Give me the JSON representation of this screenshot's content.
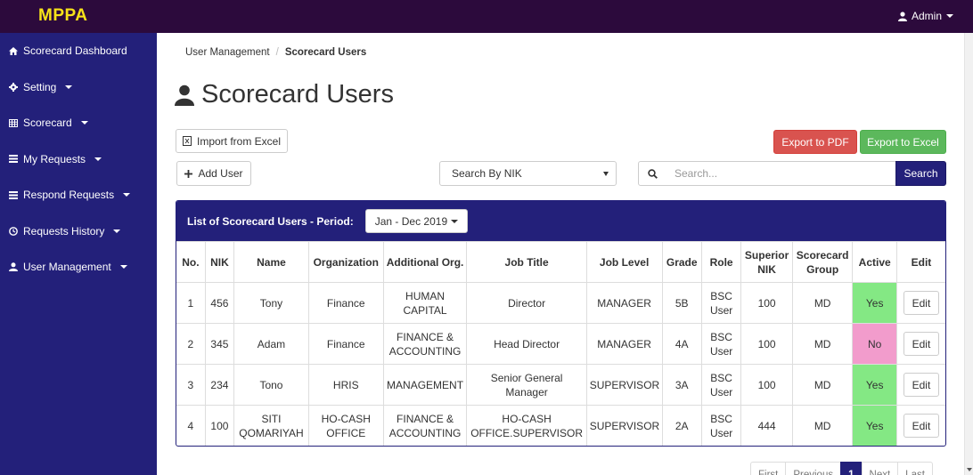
{
  "navbar": {
    "brand": "MPPA",
    "user_label": "Admin",
    "user_icon": "user-icon"
  },
  "sidebar": {
    "items": [
      {
        "label": "Scorecard Dashboard",
        "icon": "home-icon"
      },
      {
        "label": "Setting",
        "icon": "gear-icon"
      },
      {
        "label": "Scorecard",
        "icon": "table-icon"
      },
      {
        "label": "My Requests",
        "icon": "list-icon"
      },
      {
        "label": "Respond Requests",
        "icon": "list-icon"
      },
      {
        "label": "Requests History",
        "icon": "clock-icon"
      },
      {
        "label": "User Management",
        "icon": "user-icon"
      }
    ]
  },
  "breadcrumb": {
    "parent": "User Management",
    "separator": "/",
    "current": "Scorecard Users"
  },
  "page": {
    "title": "Scorecard Users"
  },
  "toolbar": {
    "import_label": "Import from Excel",
    "export_pdf_label": "Export to PDF",
    "export_excel_label": "Export to Excel",
    "add_user_label": "Add User",
    "search_by_value": "Search By NIK",
    "search_placeholder": "Search...",
    "search_button_label": "Search"
  },
  "panel": {
    "title": "List of Scorecard Users - Period:",
    "period_value": "Jan - Dec 2019"
  },
  "table": {
    "headers": {
      "no": "No.",
      "nik": "NIK",
      "name": "Name",
      "org": "Organization",
      "add_org": "Additional Org.",
      "job_title": "Job Title",
      "job_level": "Job Level",
      "grade": "Grade",
      "role": "Role",
      "superior": "Superior NIK",
      "group": "Scorecard Group",
      "active": "Active",
      "edit": "Edit"
    },
    "rows": [
      {
        "no": "1",
        "nik": "456",
        "name": "Tony",
        "org": "Finance",
        "add_org": "HUMAN CAPITAL",
        "job_title": "Director",
        "job_level": "MANAGER",
        "grade": "5B",
        "role": "BSC User",
        "superior": "100",
        "group": "MD",
        "active": "Yes",
        "edit": "Edit"
      },
      {
        "no": "2",
        "nik": "345",
        "name": "Adam",
        "org": "Finance",
        "add_org": "FINANCE & ACCOUNTING",
        "job_title": "Head Director",
        "job_level": "MANAGER",
        "grade": "4A",
        "role": "BSC User",
        "superior": "100",
        "group": "MD",
        "active": "No",
        "edit": "Edit"
      },
      {
        "no": "3",
        "nik": "234",
        "name": "Tono",
        "org": "HRIS",
        "add_org": "MANAGEMENT",
        "job_title": "Senior General Manager",
        "job_level": "SUPERVISOR",
        "grade": "3A",
        "role": "BSC User",
        "superior": "100",
        "group": "MD",
        "active": "Yes",
        "edit": "Edit"
      },
      {
        "no": "4",
        "nik": "100",
        "name": "SITI QOMARIYAH",
        "org": "HO-CASH OFFICE",
        "add_org": "FINANCE & ACCOUNTING",
        "job_title": "HO-CASH OFFICE.SUPERVISOR",
        "job_level": "SUPERVISOR",
        "grade": "2A",
        "role": "BSC User",
        "superior": "444",
        "group": "MD",
        "active": "Yes",
        "edit": "Edit"
      }
    ]
  },
  "pagination": {
    "first": "First",
    "previous": "Previous",
    "current": "1",
    "next": "Next",
    "last": "Last"
  },
  "colors": {
    "navbar_bg": "#2c0a3c",
    "sidebar_bg": "#23207a",
    "brand": "#f6e219",
    "active_yes": "#84e884",
    "active_no": "#f29ccc",
    "danger": "#d9534f",
    "success": "#5cb85c"
  }
}
